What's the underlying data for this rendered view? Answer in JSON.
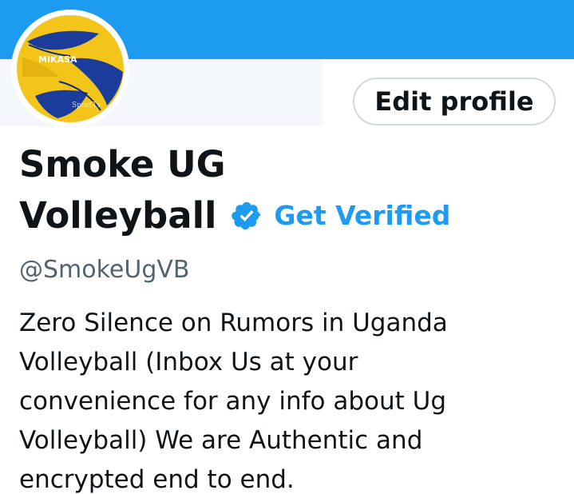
{
  "profile": {
    "name_line1": "Smoke UG",
    "name_line2": "Volleyball",
    "get_verified_label": "Get Verified",
    "handle": "@SmokeUgVB",
    "bio": "Zero Silence on Rumors in Uganda\nVolleyball (Inbox Us at your\nconvenience for any info about Ug\nVolleyball)  We are Authentic and\nencrypted end to end.",
    "avatar": {
      "brand_text": "MIKASA",
      "watermark_text": "SportTv"
    }
  },
  "actions": {
    "edit_profile_label": "Edit profile"
  },
  "icons": {
    "verified": "verified-badge-icon"
  },
  "colors": {
    "banner": "#1d9bf0",
    "accent": "#1d9bf0",
    "text_primary": "#0f1419",
    "text_secondary": "#536471"
  }
}
